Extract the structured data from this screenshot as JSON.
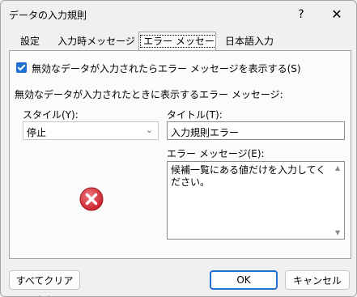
{
  "window": {
    "title": "データの入力規則",
    "help_label": "?",
    "close_label": "✕"
  },
  "tabs": [
    {
      "label": "設定"
    },
    {
      "label": "入力時メッセージ"
    },
    {
      "label": "エラー メッセージ",
      "active": true
    },
    {
      "label": "日本語入力"
    }
  ],
  "panel": {
    "show_error_checkbox": {
      "checked": true,
      "label": "無効なデータが入力されたらエラー メッセージを表示する(S)"
    },
    "section_label": "無効なデータが入力されたときに表示するエラー メッセージ:",
    "style_label": "スタイル(Y):",
    "style_value": "停止",
    "title_label": "タイトル(T):",
    "title_value": "入力規則エラー",
    "message_label": "エラー メッセージ(E):",
    "message_value": "候補一覧にある値だけを入力してください。",
    "icon": "error-stop-icon"
  },
  "buttons": {
    "clear_all": "すべてクリア(C)",
    "ok": "OK",
    "cancel": "キャンセル"
  },
  "colors": {
    "accent": "#1f6fd0",
    "error_icon": "#d9363e"
  }
}
